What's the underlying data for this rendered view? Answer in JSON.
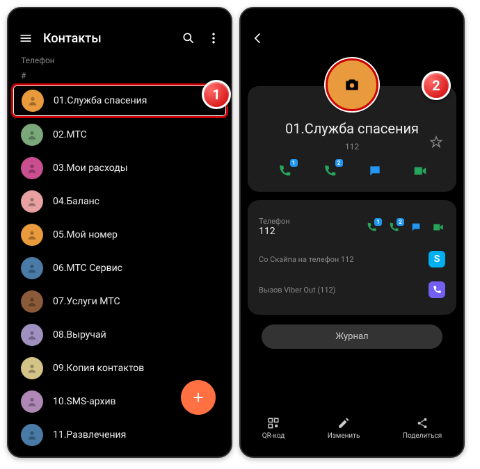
{
  "left": {
    "title": "Контакты",
    "subheader": "Телефон",
    "section": "#",
    "contacts": [
      {
        "name": "01.Служба спасения",
        "color": "#e89a3c",
        "highlighted": true
      },
      {
        "name": "02.МТС",
        "color": "#7aa87a"
      },
      {
        "name": "03.Мои расходы",
        "color": "#c94f8f"
      },
      {
        "name": "04.Баланс",
        "color": "#e8a0a0"
      },
      {
        "name": "05.Мой номер",
        "color": "#e89a3c"
      },
      {
        "name": "06.МТС Сервис",
        "color": "#4a7ba6"
      },
      {
        "name": "07.Услуги МТС",
        "color": "#8a5a3a"
      },
      {
        "name": "08.Выручай",
        "color": "#a090c0"
      },
      {
        "name": "09.Копия контактов",
        "color": "#d4c488"
      },
      {
        "name": "10.SMS-архив",
        "color": "#b088b8"
      },
      {
        "name": "11.Развлечения",
        "color": "#4a7ba6"
      }
    ],
    "badge": "1"
  },
  "right": {
    "badge": "2",
    "name": "01.Служба спасения",
    "number": "112",
    "phone_section_label": "Телефон",
    "phone_value": "112",
    "skype_label": "Со Скайпа на телефон 112",
    "viber_label": "Вызов Viber Out (112)",
    "journal": "Журнал",
    "bottom": {
      "qr": "QR-код",
      "edit": "Изменить",
      "share": "Поделиться"
    }
  }
}
